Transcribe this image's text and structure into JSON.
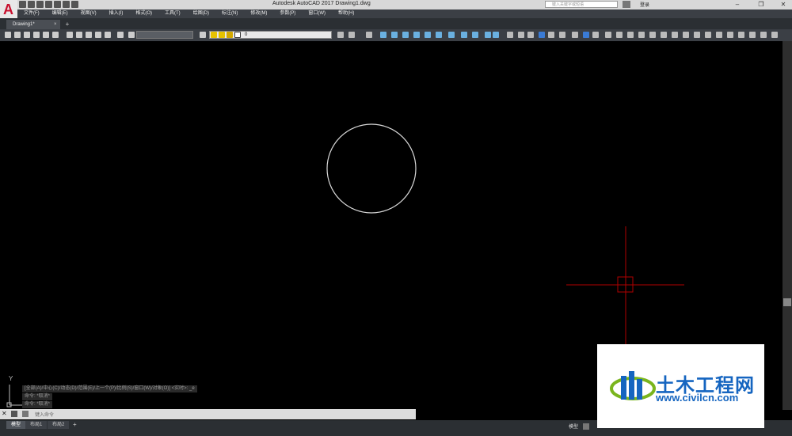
{
  "app": {
    "title": "Autodesk AutoCAD 2017    Drawing1.dwg",
    "search_placeholder": "键入关键字或短语",
    "login_label": "登录"
  },
  "menu": [
    "文件(F)",
    "编辑(E)",
    "视图(V)",
    "插入(I)",
    "格式(O)",
    "工具(T)",
    "绘图(D)",
    "标注(N)",
    "修改(M)",
    "参数(P)",
    "窗口(W)",
    "帮助(H)"
  ],
  "tabs": {
    "document": "Drawing1*",
    "close_glyph": "×",
    "new_glyph": "+"
  },
  "toolbar": {
    "layer_name": "0"
  },
  "command": {
    "history": [
      "[全部(A)/中心(C)/动态(D)/范围(E)/上一个(P)/比例(S)/窗口(W)/对象(O)] <实时>: _e",
      "命令: *取消*",
      "命令: *取消*"
    ],
    "placeholder": "键入命令",
    "close_glyph": "✕"
  },
  "layout_tabs": [
    "模型",
    "布局1",
    "布局2"
  ],
  "status": {
    "model_label": "模型"
  },
  "ucs": {
    "y_label": "Y"
  },
  "watermark": {
    "title": "土木工程网",
    "url": "www.civilcn.com"
  },
  "colors": {
    "canvas": "#000000",
    "circle": "#d9d9d9",
    "crosshair": "#b00000",
    "accent": "#1565c0"
  }
}
